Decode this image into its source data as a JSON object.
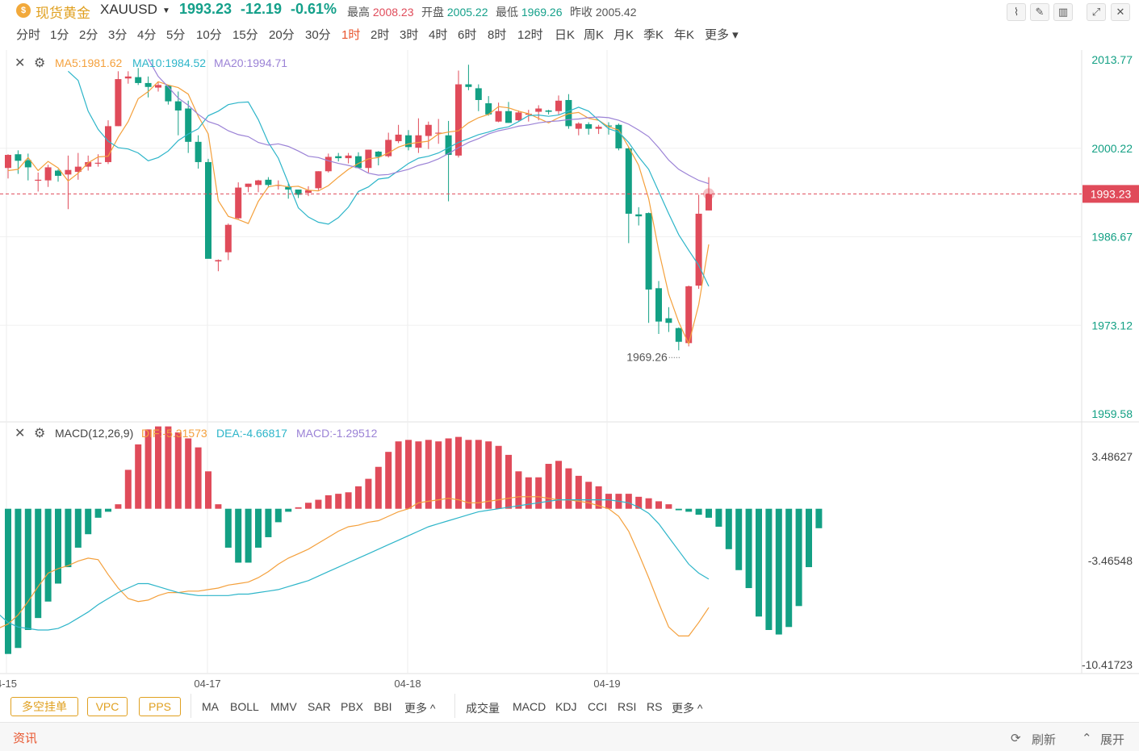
{
  "header": {
    "coin_glyph": "$",
    "title": "现货黄金",
    "symbol": "XAUUSD",
    "price": "1993.23",
    "change": "-12.19",
    "change_pct": "-0.61%",
    "high_label": "最高",
    "high": "2008.23",
    "open_label": "开盘",
    "open": "2005.22",
    "low_label": "最低",
    "low": "1969.26",
    "prev_label": "昨收",
    "prev": "2005.42"
  },
  "periods": [
    "分时",
    "1分",
    "2分",
    "3分",
    "4分",
    "5分",
    "10分",
    "15分",
    "20分",
    "30分",
    "1时",
    "2时",
    "3时",
    "4时",
    "6时",
    "8时",
    "12时",
    "日K",
    "周K",
    "月K",
    "季K",
    "年K",
    "更多"
  ],
  "active_period": "1时",
  "ma_legend": {
    "ma5": "MA5:1981.62",
    "ma10": "MA10:1984.52",
    "ma20": "MA20:1994.71"
  },
  "macd_legend": {
    "name": "MACD(12,26,9)",
    "dif": "DIF:-5.31573",
    "dea": "DEA:-4.66817",
    "macd": "MACD:-1.29512"
  },
  "price_axis_labels": [
    "2013.77",
    "2000.22",
    "1986.67",
    "1973.12",
    "1959.58"
  ],
  "current_price_label": "1993.23",
  "macd_axis_labels": [
    "3.48627",
    "-3.46548",
    "-10.41723"
  ],
  "low_annotation": "1969.26",
  "date_labels": [
    "4-15",
    "04-17",
    "04-18",
    "04-19"
  ],
  "bottom_tags": [
    "多空挂单",
    "VPC",
    "PPS"
  ],
  "main_indicators": [
    "MA",
    "BOLL",
    "MMV",
    "SAR",
    "PBX",
    "BBI",
    "更多 ^"
  ],
  "sub_indicators": [
    "成交量",
    "MACD",
    "KDJ",
    "CCI",
    "RSI",
    "RS",
    "更多 ^"
  ],
  "news": {
    "label": "资讯",
    "refresh": "刷新",
    "expand": "展开"
  },
  "colors": {
    "up": "#e04b5a",
    "down": "#13a084",
    "ma5": "#f4a03c",
    "ma10": "#2db5c9",
    "ma20": "#9b82d6",
    "accent": "#e8552e",
    "brand": "#e0a020"
  },
  "chart_data": {
    "type": "candlestick",
    "price_range": [
      1959.58,
      2013.77
    ],
    "macd_range": [
      -10.41723,
      3.48627
    ],
    "candles": [
      {
        "o": 1997.2,
        "h": 1999.3,
        "l": 1995.6,
        "c": 1999.2
      },
      {
        "o": 1999.3,
        "h": 1999.9,
        "l": 1996.3,
        "c": 1998.3
      },
      {
        "o": 1998.4,
        "h": 1999.4,
        "l": 1995.3,
        "c": 1997.3
      },
      {
        "o": 1995.3,
        "h": 1996.5,
        "l": 1993.6,
        "c": 1995.4
      },
      {
        "o": 1995.3,
        "h": 1997.7,
        "l": 1994.3,
        "c": 1997.3
      },
      {
        "o": 1996.8,
        "h": 1997.0,
        "l": 1995.1,
        "c": 1996.0
      },
      {
        "o": 1996.2,
        "h": 1999.1,
        "l": 1990.9,
        "c": 1996.9
      },
      {
        "o": 1996.6,
        "h": 1999.5,
        "l": 1995.4,
        "c": 1997.4
      },
      {
        "o": 1997.4,
        "h": 1999.1,
        "l": 1996.8,
        "c": 1998.1
      },
      {
        "o": 1997.9,
        "h": 1999.3,
        "l": 1997.4,
        "c": 1998.0
      },
      {
        "o": 1998.1,
        "h": 2004.5,
        "l": 1997.8,
        "c": 2003.6
      },
      {
        "o": 2003.6,
        "h": 2012.0,
        "l": 2003.6,
        "c": 2010.8
      },
      {
        "o": 2010.9,
        "h": 2012.0,
        "l": 2010.1,
        "c": 2011.2
      },
      {
        "o": 2011.1,
        "h": 2012.5,
        "l": 2009.9,
        "c": 2010.2
      },
      {
        "o": 2010.2,
        "h": 2011.2,
        "l": 2008.0,
        "c": 2009.6
      },
      {
        "o": 2009.5,
        "h": 2010.3,
        "l": 2008.9,
        "c": 2009.9
      },
      {
        "o": 2009.8,
        "h": 2009.9,
        "l": 2006.9,
        "c": 2007.4
      },
      {
        "o": 2007.4,
        "h": 2008.9,
        "l": 2002.2,
        "c": 2006.0
      },
      {
        "o": 2006.3,
        "h": 2007.5,
        "l": 1999.5,
        "c": 2001.2
      },
      {
        "o": 2001.2,
        "h": 2002.2,
        "l": 1997.1,
        "c": 1998.1
      },
      {
        "o": 1998.1,
        "h": 1998.6,
        "l": 1987.5,
        "c": 1983.3
      },
      {
        "o": 1982.9,
        "h": 1983.2,
        "l": 1981.4,
        "c": 1983.1
      },
      {
        "o": 1984.3,
        "h": 1988.7,
        "l": 1983.1,
        "c": 1988.5
      },
      {
        "o": 1989.5,
        "h": 1995.0,
        "l": 1989.4,
        "c": 1994.2
      },
      {
        "o": 1994.3,
        "h": 1994.8,
        "l": 1993.5,
        "c": 1994.8
      },
      {
        "o": 1994.6,
        "h": 1995.4,
        "l": 1993.5,
        "c": 1995.3
      },
      {
        "o": 1995.4,
        "h": 1995.8,
        "l": 1994.2,
        "c": 1994.6
      },
      {
        "o": 1994.6,
        "h": 1995.3,
        "l": 1993.9,
        "c": 1994.6
      },
      {
        "o": 1994.3,
        "h": 1994.8,
        "l": 1992.5,
        "c": 1993.9
      },
      {
        "o": 1993.9,
        "h": 1993.9,
        "l": 1992.6,
        "c": 1993.1
      },
      {
        "o": 1993.4,
        "h": 1994.4,
        "l": 1992.9,
        "c": 1993.8
      },
      {
        "o": 1994.1,
        "h": 1996.7,
        "l": 1993.8,
        "c": 1996.7
      },
      {
        "o": 1996.7,
        "h": 1999.4,
        "l": 1996.5,
        "c": 1998.9
      },
      {
        "o": 1999.0,
        "h": 1999.5,
        "l": 1998.2,
        "c": 1998.7
      },
      {
        "o": 1998.7,
        "h": 1999.5,
        "l": 1997.9,
        "c": 1999.1
      },
      {
        "o": 1999.0,
        "h": 1999.6,
        "l": 1997.2,
        "c": 1997.2
      },
      {
        "o": 1997.2,
        "h": 2000.0,
        "l": 1996.5,
        "c": 2000.0
      },
      {
        "o": 1999.7,
        "h": 1999.8,
        "l": 1997.6,
        "c": 1998.9
      },
      {
        "o": 1999.0,
        "h": 2002.6,
        "l": 1998.8,
        "c": 2001.5
      },
      {
        "o": 2001.3,
        "h": 2003.8,
        "l": 2001.0,
        "c": 2002.3
      },
      {
        "o": 2002.2,
        "h": 2003.0,
        "l": 1999.9,
        "c": 2000.4
      },
      {
        "o": 2000.3,
        "h": 2004.8,
        "l": 1999.5,
        "c": 2002.2
      },
      {
        "o": 2002.1,
        "h": 2004.3,
        "l": 2000.1,
        "c": 2003.8
      },
      {
        "o": 2002.5,
        "h": 2004.7,
        "l": 2000.9,
        "c": 2002.6
      },
      {
        "o": 2002.2,
        "h": 2004.4,
        "l": 1992.1,
        "c": 1999.2
      },
      {
        "o": 1999.1,
        "h": 2012.1,
        "l": 1998.8,
        "c": 2010.0
      },
      {
        "o": 2010.0,
        "h": 2013.0,
        "l": 2009.1,
        "c": 2009.6
      },
      {
        "o": 2009.4,
        "h": 2010.0,
        "l": 2005.9,
        "c": 2007.6
      },
      {
        "o": 2007.1,
        "h": 2008.2,
        "l": 2005.2,
        "c": 2005.4
      },
      {
        "o": 2004.3,
        "h": 2007.2,
        "l": 2004.2,
        "c": 2005.9
      },
      {
        "o": 2005.9,
        "h": 2007.3,
        "l": 2004.1,
        "c": 2004.1
      },
      {
        "o": 2004.5,
        "h": 2006.0,
        "l": 2004.4,
        "c": 2005.7
      },
      {
        "o": 2005.5,
        "h": 2006.1,
        "l": 2004.3,
        "c": 2005.5
      },
      {
        "o": 2005.8,
        "h": 2006.8,
        "l": 2004.5,
        "c": 2006.3
      },
      {
        "o": 2006.0,
        "h": 2006.1,
        "l": 2005.4,
        "c": 2005.8
      },
      {
        "o": 2005.9,
        "h": 2008.3,
        "l": 2005.4,
        "c": 2007.5
      },
      {
        "o": 2007.6,
        "h": 2008.5,
        "l": 2003.2,
        "c": 2003.6
      },
      {
        "o": 2003.2,
        "h": 2004.2,
        "l": 2002.2,
        "c": 2004.0
      },
      {
        "o": 2003.9,
        "h": 2004.2,
        "l": 2002.3,
        "c": 2003.2
      },
      {
        "o": 2003.2,
        "h": 2003.8,
        "l": 2002.4,
        "c": 2003.5
      },
      {
        "o": 2003.7,
        "h": 2004.2,
        "l": 2002.3,
        "c": 2003.6
      },
      {
        "o": 2003.8,
        "h": 2004.0,
        "l": 1999.9,
        "c": 2000.2
      },
      {
        "o": 2000.2,
        "h": 2000.4,
        "l": 1985.7,
        "c": 1990.2
      },
      {
        "o": 1990.1,
        "h": 1991.2,
        "l": 1988.4,
        "c": 1989.8
      },
      {
        "o": 1990.3,
        "h": 1990.4,
        "l": 1973.5,
        "c": 1978.6
      },
      {
        "o": 1978.8,
        "h": 1979.9,
        "l": 1971.8,
        "c": 1973.7
      },
      {
        "o": 1974.2,
        "h": 1975.9,
        "l": 1972.1,
        "c": 1973.5
      },
      {
        "o": 1972.7,
        "h": 1972.8,
        "l": 1969.3,
        "c": 1970.6
      },
      {
        "o": 1970.4,
        "h": 1979.2,
        "l": 1969.9,
        "c": 1979.1
      },
      {
        "o": 1979.2,
        "h": 1993.1,
        "l": 1978.7,
        "c": 1990.2
      },
      {
        "o": 1990.7,
        "h": 1995.8,
        "l": 1990.7,
        "c": 1993.2
      }
    ],
    "ma5": [
      1996.8,
      1997.0,
      1998.8,
      1996.8,
      1998.2,
      1997.2,
      1995.2,
      1996.4,
      1998.0,
      1998.9,
      1999.0,
      2001.9,
      2004.3,
      2007.8,
      2008.9,
      2010.4,
      2009.9,
      2009.5,
      2008.5,
      2005.1,
      2002.4,
      1992.2,
      1989.8,
      1989.3,
      1988.7,
      1992.1,
      1994.3,
      1994.6,
      1994.3,
      1994.4,
      1993.8,
      1993.7,
      1994.5,
      1995.8,
      1997.0,
      1997.9,
      1998.6,
      1998.8,
      1999.5,
      2000.4,
      2000.9,
      2001.1,
      2001.3,
      2002.4,
      2002.7,
      2002.9,
      2004.1,
      2004.9,
      2005.4,
      2006.6,
      2006.4,
      2005.9,
      2005.5,
      2004.8,
      2004.1,
      2004.9,
      2005.5,
      2005.7,
      2004.8,
      2004.5,
      2003.5,
      2003.0,
      2000.4,
      1997.6,
      1992.5,
      1984.6,
      1977.9,
      1973.6,
      1970.3,
      1976.3,
      1985.5
    ],
    "ma10": [
      2012.0,
      2010.6,
      2005.9,
      2003.1,
      2001.3,
      2000.3,
      2000.1,
      1999.5,
      1998.3,
      1998.8,
      1999.8,
      2001.4,
      2002.4,
      2003.2,
      2005.2,
      2005.9,
      2006.9,
      2007.2,
      2007.3,
      2004.6,
      2001.1,
      1998.7,
      1994.9,
      1991.1,
      1989.7,
      1988.9,
      1988.6,
      1989.6,
      1991.2,
      1993.6,
      1994.3,
      1995.5,
      1995.7,
      1996.8,
      1997.9,
      1998.7,
      1999.0,
      1999.5,
      2000.3,
      2001.1,
      2001.7,
      2002.3,
      2002.7,
      2003.2,
      2003.5,
      2004.3,
      2005.2,
      2005.3,
      2005.1,
      2005.3,
      2005.9,
      2006.5,
      2005.9,
      2004.5,
      2003.2,
      2002.7,
      2001.1,
      1998.9,
      1997.0,
      1993.6,
      1990.2,
      1987.0,
      1984.6,
      1982.3,
      1979.1
    ],
    "ma20": [
      2013.9,
      2011.2,
      2009.6,
      2007.9,
      2006.8,
      2005.4,
      2004.3,
      2003.8,
      2002.9,
      2002.3,
      2002.0,
      2001.1,
      2000.7,
      2000.9,
      2000.5,
      1999.8,
      1999.0,
      1998.8,
      1998.3,
      1997.9,
      1997.6,
      1997.2,
      1996.4,
      1996.1,
      1996.2,
      1996.6,
      1997.0,
      1997.6,
      1998.0,
      1998.6,
      1999.4,
      2000.3,
      2001.1,
      2001.7,
      2002.4,
      2002.9,
      2003.2,
      2003.6,
      2003.8,
      2004.1,
      2004.3,
      2004.4,
      2004.6,
      2004.7,
      2004.9,
      2005.0,
      2004.9,
      2004.5,
      2003.9,
      2003.0,
      2002.0,
      2000.3,
      1998.4,
      1997.0,
      1996.1,
      1995.3,
      1994.8
    ],
    "macd_hist": [
      -9.7,
      -9.3,
      -8.1,
      -7.3,
      -6.2,
      -5.0,
      -3.9,
      -2.6,
      -1.7,
      -0.6,
      -0.2,
      0.3,
      2.6,
      4.3,
      5.3,
      5.5,
      5.5,
      5.1,
      4.7,
      4.1,
      2.5,
      0.3,
      -2.6,
      -3.6,
      -3.6,
      -2.6,
      -1.9,
      -0.9,
      -0.2,
      0.1,
      0.4,
      0.6,
      0.9,
      1.0,
      1.1,
      1.5,
      2.0,
      2.8,
      3.8,
      4.5,
      4.6,
      4.5,
      4.6,
      4.5,
      4.7,
      4.8,
      4.6,
      4.6,
      4.5,
      4.2,
      3.6,
      2.5,
      2.1,
      2.1,
      3.0,
      3.2,
      2.7,
      2.2,
      1.8,
      1.5,
      1.0,
      1.0,
      1.0,
      0.8,
      0.7,
      0.5,
      0.3,
      -0.1,
      -0.2,
      -0.4,
      -0.6,
      -1.2,
      -2.7,
      -4.1,
      -5.3,
      -7.2,
      -8.1,
      -8.4,
      -7.9,
      -6.5,
      -3.9,
      -1.3
    ],
    "macd_dif": [
      -6.0,
      -7.0,
      -7.5,
      -7.9,
      -8.3,
      -8.4,
      -8.5,
      -8.3,
      -8.0,
      -7.7,
      -7.1,
      -6.2,
      -5.2,
      -4.3,
      -4.0,
      -3.8,
      -3.5,
      -3.3,
      -3.4,
      -4.4,
      -5.3,
      -6.0,
      -6.2,
      -6.1,
      -5.8,
      -5.6,
      -5.6,
      -5.5,
      -5.5,
      -5.4,
      -5.3,
      -5.1,
      -5.0,
      -4.9,
      -4.6,
      -4.2,
      -3.7,
      -3.3,
      -3.0,
      -2.7,
      -2.3,
      -1.9,
      -1.5,
      -1.2,
      -1.1,
      -0.9,
      -0.8,
      -0.5,
      -0.2,
      0.0,
      0.4,
      0.5,
      0.6,
      0.7,
      0.6,
      0.4,
      0.4,
      0.5,
      0.6,
      0.7,
      0.8,
      0.8,
      0.8,
      0.7,
      0.6,
      0.6,
      0.5,
      0.4,
      0.2,
      0.0,
      -0.5,
      -1.5,
      -3.0,
      -4.6,
      -6.3,
      -7.9,
      -8.5,
      -8.5,
      -7.6,
      -6.6
    ],
    "macd_dea": [
      -3.2,
      -4.5,
      -5.5,
      -6.4,
      -7.0,
      -7.6,
      -7.9,
      -8.0,
      -8.1,
      -8.1,
      -8.0,
      -7.7,
      -7.3,
      -6.9,
      -6.4,
      -6.0,
      -5.6,
      -5.3,
      -5.0,
      -5.0,
      -5.2,
      -5.4,
      -5.6,
      -5.7,
      -5.8,
      -5.8,
      -5.8,
      -5.8,
      -5.7,
      -5.7,
      -5.6,
      -5.5,
      -5.4,
      -5.2,
      -5.0,
      -4.8,
      -4.5,
      -4.2,
      -3.9,
      -3.6,
      -3.3,
      -3.0,
      -2.7,
      -2.4,
      -2.1,
      -1.8,
      -1.5,
      -1.2,
      -1.0,
      -0.8,
      -0.6,
      -0.4,
      -0.2,
      -0.1,
      0.0,
      0.1,
      0.2,
      0.3,
      0.4,
      0.5,
      0.6,
      0.6,
      0.6,
      0.6,
      0.6,
      0.6,
      0.5,
      0.4,
      0.1,
      -0.3,
      -1.0,
      -1.9,
      -2.8,
      -3.7,
      -4.3,
      -4.7
    ]
  }
}
